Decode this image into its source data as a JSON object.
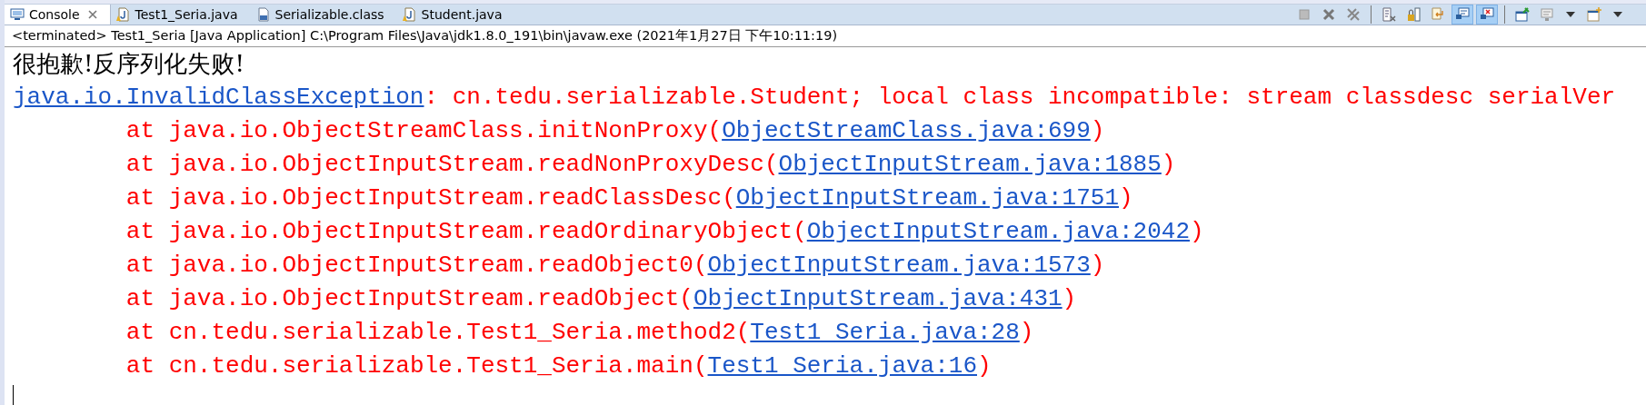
{
  "tabs": [
    {
      "label": "Console",
      "kind": "console",
      "selected": true
    },
    {
      "label": "Test1_Seria.java",
      "kind": "java",
      "selected": false
    },
    {
      "label": "Serializable.class",
      "kind": "class",
      "selected": false
    },
    {
      "label": "Student.java",
      "kind": "java",
      "selected": false
    }
  ],
  "toolbar": [
    {
      "pressed": false
    },
    {
      "pressed": false
    },
    {
      "pressed": false
    },
    {
      "pressed": false
    },
    {
      "pressed": false
    },
    {
      "pressed": false
    },
    {
      "pressed": true
    },
    {
      "pressed": true
    },
    {
      "pressed": false
    },
    {
      "pressed": false
    },
    {
      "pressed": false
    }
  ],
  "console": {
    "status": "<terminated> Test1_Seria [Java Application] C:\\Program Files\\Java\\jdk1.8.0_191\\bin\\javaw.exe (2021年1月27日 下午10:11:19)",
    "lines": [
      {
        "kind": "stdout",
        "parts": [
          {
            "kind": "text",
            "text": "很抱歉!反序列化失败!"
          }
        ]
      },
      {
        "kind": "stderr",
        "parts": [
          {
            "kind": "link",
            "text": "java.io.InvalidClassException"
          },
          {
            "kind": "text",
            "text": ": cn.tedu.serializable.Student; local class incompatible: stream classdesc serialVer"
          }
        ]
      },
      {
        "kind": "stderr",
        "parts": [
          {
            "kind": "text",
            "text": "\tat java.io.ObjectStreamClass.initNonProxy("
          },
          {
            "kind": "link",
            "text": "ObjectStreamClass.java:699"
          },
          {
            "kind": "text",
            "text": ")"
          }
        ]
      },
      {
        "kind": "stderr",
        "parts": [
          {
            "kind": "text",
            "text": "\tat java.io.ObjectInputStream.readNonProxyDesc("
          },
          {
            "kind": "link",
            "text": "ObjectInputStream.java:1885"
          },
          {
            "kind": "text",
            "text": ")"
          }
        ]
      },
      {
        "kind": "stderr",
        "parts": [
          {
            "kind": "text",
            "text": "\tat java.io.ObjectInputStream.readClassDesc("
          },
          {
            "kind": "link",
            "text": "ObjectInputStream.java:1751"
          },
          {
            "kind": "text",
            "text": ")"
          }
        ]
      },
      {
        "kind": "stderr",
        "parts": [
          {
            "kind": "text",
            "text": "\tat java.io.ObjectInputStream.readOrdinaryObject("
          },
          {
            "kind": "link",
            "text": "ObjectInputStream.java:2042"
          },
          {
            "kind": "text",
            "text": ")"
          }
        ]
      },
      {
        "kind": "stderr",
        "parts": [
          {
            "kind": "text",
            "text": "\tat java.io.ObjectInputStream.readObject0("
          },
          {
            "kind": "link",
            "text": "ObjectInputStream.java:1573"
          },
          {
            "kind": "text",
            "text": ")"
          }
        ]
      },
      {
        "kind": "stderr",
        "parts": [
          {
            "kind": "text",
            "text": "\tat java.io.ObjectInputStream.readObject("
          },
          {
            "kind": "link",
            "text": "ObjectInputStream.java:431"
          },
          {
            "kind": "text",
            "text": ")"
          }
        ]
      },
      {
        "kind": "stderr",
        "parts": [
          {
            "kind": "text",
            "text": "\tat cn.tedu.serializable.Test1_Seria.method2("
          },
          {
            "kind": "link",
            "text": "Test1_Seria.java:28"
          },
          {
            "kind": "text",
            "text": ")"
          }
        ]
      },
      {
        "kind": "stderr",
        "parts": [
          {
            "kind": "text",
            "text": "\tat cn.tedu.serializable.Test1_Seria.main("
          },
          {
            "kind": "link",
            "text": "Test1_Seria.java:16"
          },
          {
            "kind": "text",
            "text": ")"
          }
        ]
      }
    ]
  }
}
